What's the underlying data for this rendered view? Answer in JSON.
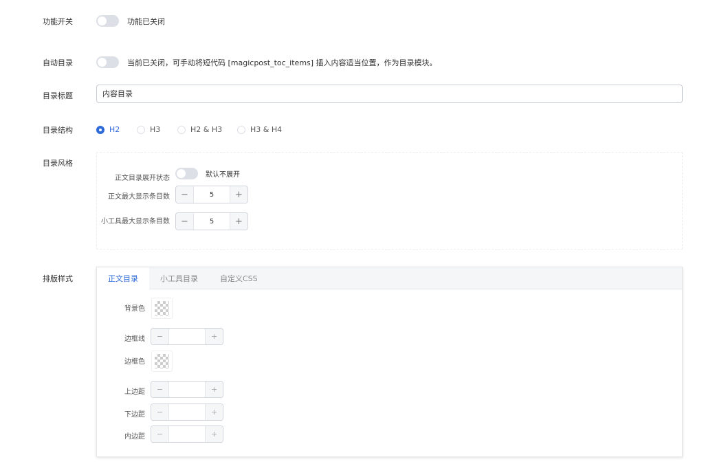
{
  "feature_switch": {
    "label": "功能开关",
    "status": "功能已关闭"
  },
  "auto_toc": {
    "label": "自动目录",
    "status": "当前已关闭，可手动将短代码 [magicpost_toc_items] 插入内容适当位置，作为目录模块。"
  },
  "toc_title": {
    "label": "目录标题",
    "value": "内容目录"
  },
  "toc_structure": {
    "label": "目录结构",
    "options": [
      "H2",
      "H3",
      "H2 & H3",
      "H3 & H4"
    ],
    "selected": "H2"
  },
  "toc_style": {
    "label": "目录风格",
    "expand_label": "正文目录展开状态",
    "expand_status": "默认不展开",
    "max_items_label": "正文最大显示条目数",
    "max_items_value": "5",
    "widget_max_label": "小工具最大显示条目数",
    "widget_max_value": "5",
    "minus": "−",
    "plus": "+"
  },
  "layout_style": {
    "label": "排版样式",
    "tabs": [
      "正文目录",
      "小工具目录",
      "自定义CSS"
    ],
    "active_tab": "正文目录",
    "fields": {
      "bg_color": "背景色",
      "border_line": "边框线",
      "border_color": "边框色",
      "margin_top": "上边距",
      "margin_bottom": "下边距",
      "padding": "内边距"
    }
  },
  "colors": {
    "accent": "#2f6bd8"
  }
}
